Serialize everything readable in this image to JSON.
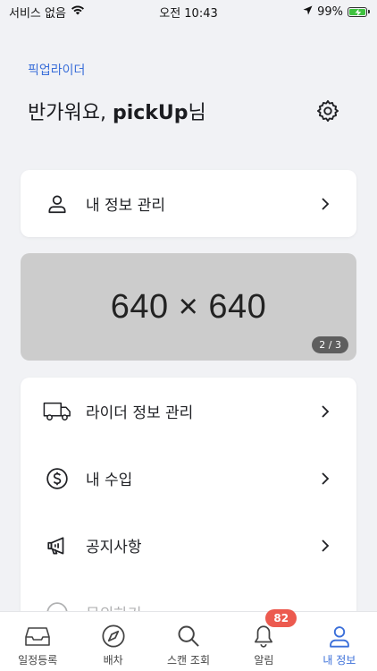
{
  "status_bar": {
    "carrier": "서비스 없음",
    "time": "오전 10:43",
    "battery": "99%"
  },
  "header": {
    "brand": "픽업라이더",
    "greeting_prefix": "반가워요, ",
    "user_name": "pickUp",
    "greeting_suffix": "님"
  },
  "profile_card": {
    "label": "내 정보 관리"
  },
  "banner": {
    "placeholder": "640 × 640",
    "pager": "2 / 3"
  },
  "menu": {
    "items": [
      {
        "label": "라이더 정보 관리",
        "icon": "truck-icon"
      },
      {
        "label": "내 수입",
        "icon": "dollar-icon"
      },
      {
        "label": "공지사항",
        "icon": "megaphone-icon"
      },
      {
        "label": "문의하기",
        "icon": "help-icon"
      }
    ]
  },
  "tabbar": {
    "items": [
      {
        "label": "일정등록",
        "icon": "inbox-icon"
      },
      {
        "label": "배차",
        "icon": "compass-icon"
      },
      {
        "label": "스캔 조회",
        "icon": "search-icon"
      },
      {
        "label": "알림",
        "icon": "bell-icon"
      },
      {
        "label": "내 정보",
        "icon": "user-icon"
      }
    ],
    "alert_badge": "82",
    "active": "내 정보"
  },
  "colors": {
    "accent": "#3b6fd9",
    "badge": "#ec5a4f",
    "battery": "#3ec23e"
  }
}
